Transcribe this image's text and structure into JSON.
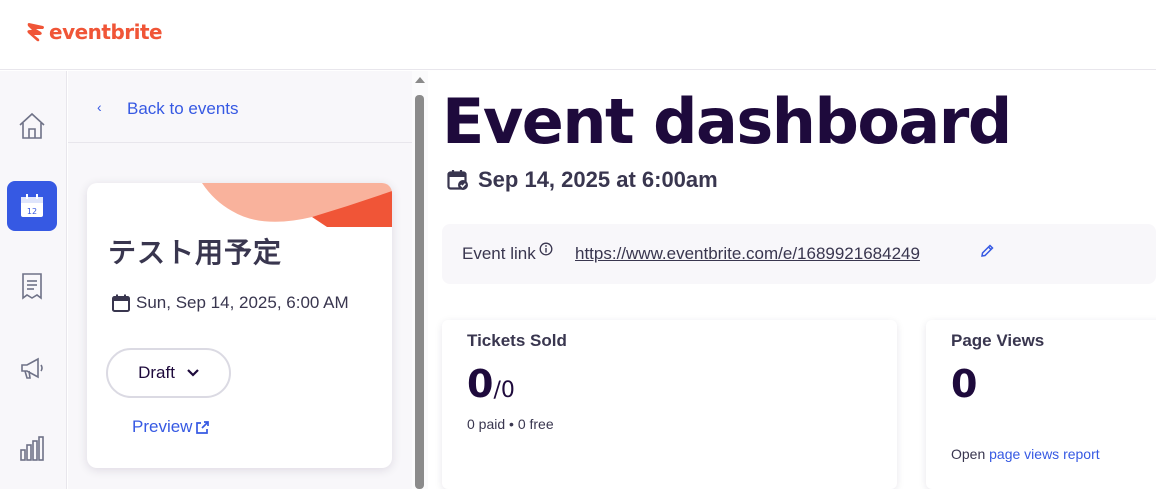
{
  "brand": {
    "name": "eventbrite",
    "color": "#f05537"
  },
  "rail": {
    "items": [
      {
        "icon": "home-icon",
        "active": false
      },
      {
        "icon": "calendar-icon",
        "active": true,
        "badge": "12"
      },
      {
        "icon": "receipt-icon",
        "active": false
      },
      {
        "icon": "megaphone-icon",
        "active": false
      },
      {
        "icon": "bar-chart-icon",
        "active": false
      }
    ],
    "accent": "#3659e3"
  },
  "panel": {
    "back_label": "Back to events",
    "back_chevron": "‹",
    "card": {
      "title": "テスト用予定",
      "date": "Sun, Sep 14, 2025, 6:00 AM",
      "status": "Draft",
      "preview_label": "Preview"
    }
  },
  "main": {
    "title": "Event dashboard",
    "event_date": "Sep 14, 2025 at 6:00am",
    "event_link_label": "Event link",
    "event_link_url": "https://www.eventbrite.com/e/1689921684249",
    "tickets": {
      "title": "Tickets Sold",
      "sold": "0",
      "capacity": "/0",
      "breakdown": "0 paid • 0 free"
    },
    "views": {
      "title": "Page Views",
      "count": "0",
      "foot_prefix": "Open ",
      "foot_link": "page views report"
    }
  }
}
